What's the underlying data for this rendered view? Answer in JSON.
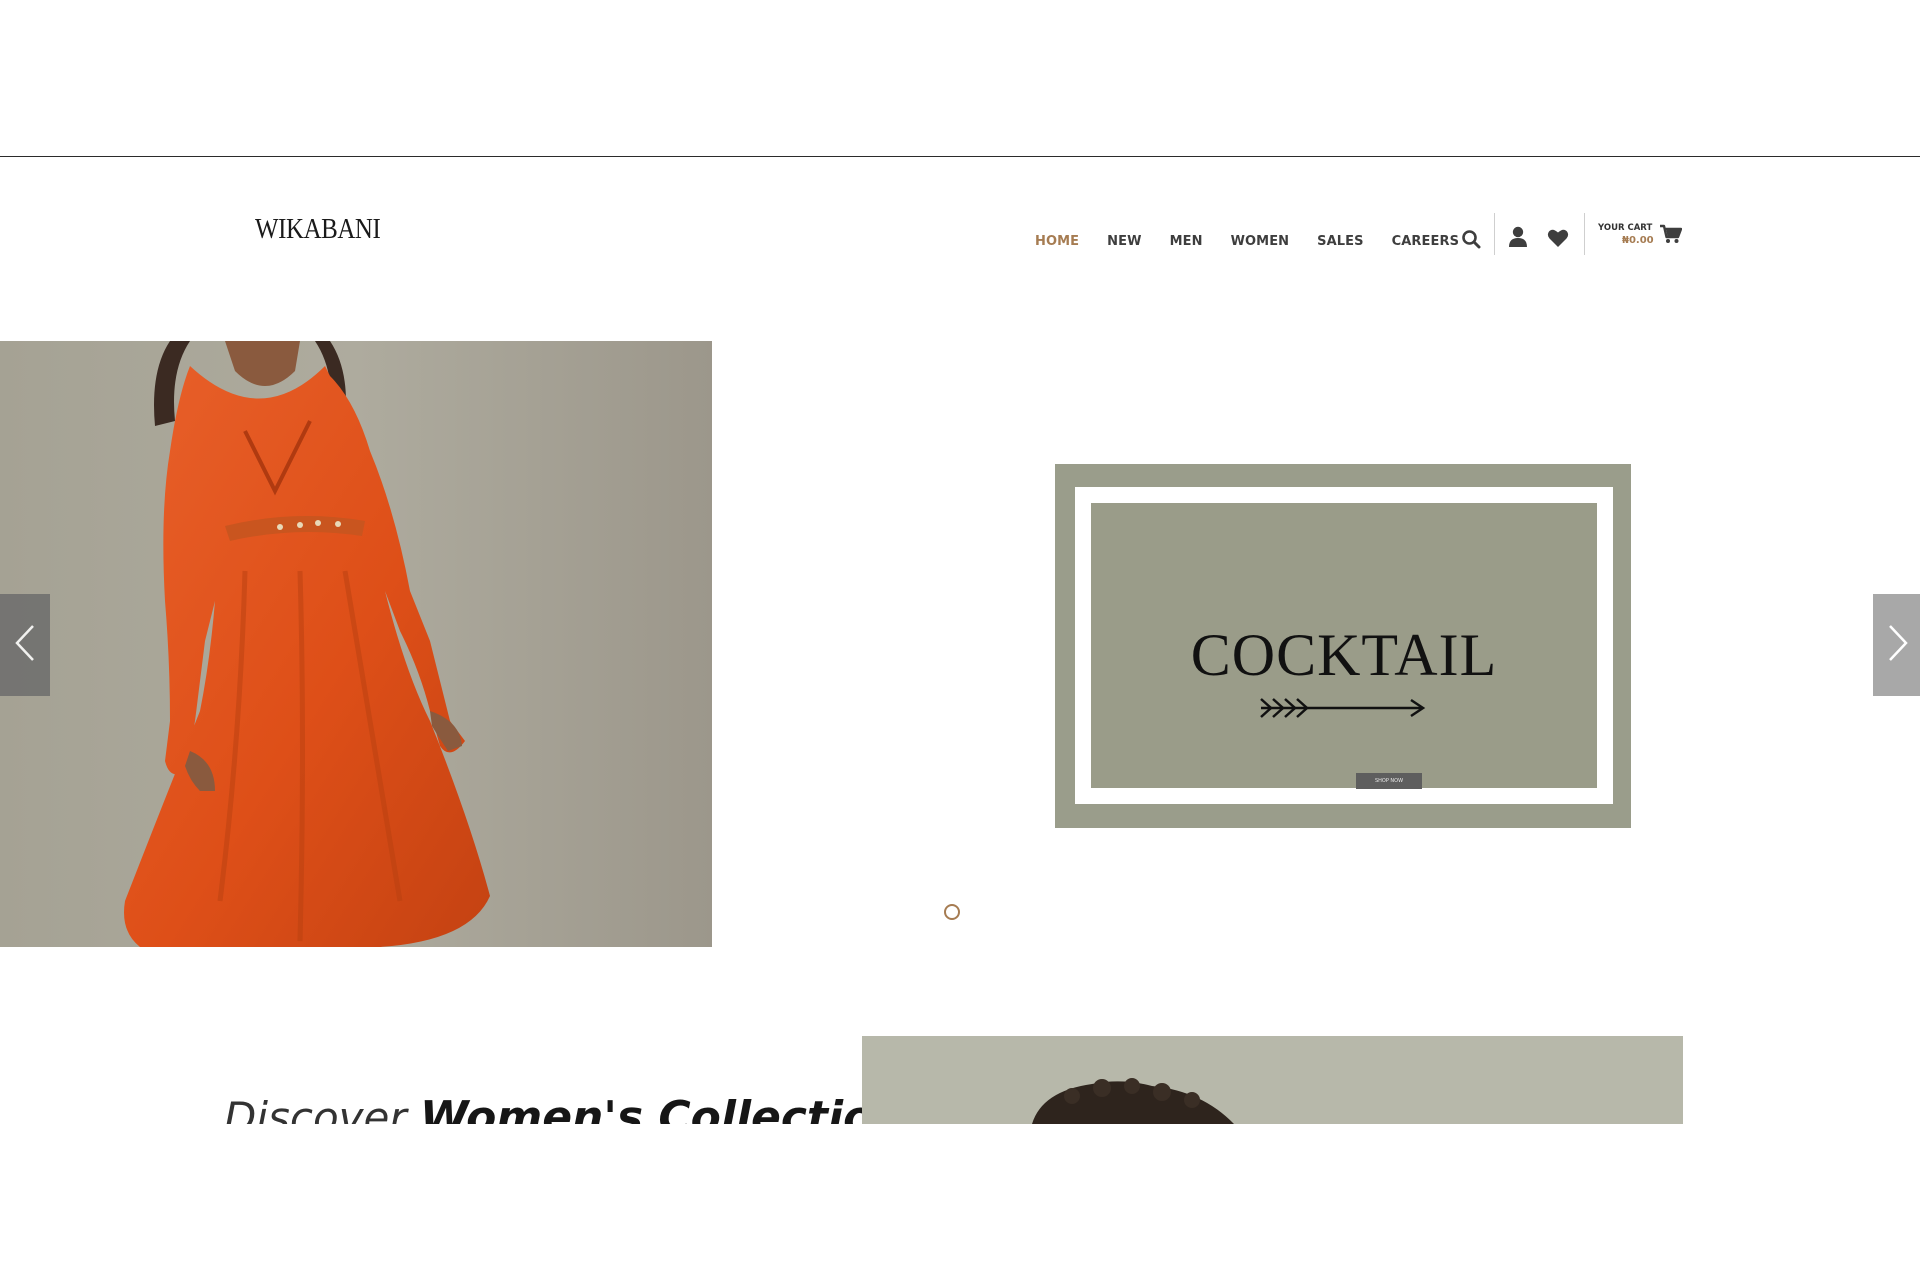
{
  "brand": {
    "logo_text": "WIKABANI"
  },
  "nav": {
    "items": [
      {
        "label": "HOME",
        "active": true
      },
      {
        "label": "NEW",
        "active": false
      },
      {
        "label": "MEN",
        "active": false
      },
      {
        "label": "WOMEN",
        "active": false
      },
      {
        "label": "SALES",
        "active": false
      },
      {
        "label": "CAREERS",
        "active": false
      }
    ],
    "icons": [
      "search-icon",
      "user-icon",
      "heart-icon",
      "cart-icon"
    ]
  },
  "cart": {
    "label": "YOUR CART",
    "amount": "₦0.00"
  },
  "slider": {
    "banner_title": "COCKTAIL",
    "banner_button": "SHOP NOW",
    "prev_icon": "chevron-left-icon",
    "next_icon": "chevron-right-icon",
    "dots": 1
  },
  "discover": {
    "light_text": "Discover ",
    "bold_text": "Women's Collection"
  },
  "colors": {
    "accent": "#a67c52",
    "nav_text": "#3e3e3e",
    "banner_bg": "#9a9d8b",
    "dress": "#e0521c"
  }
}
